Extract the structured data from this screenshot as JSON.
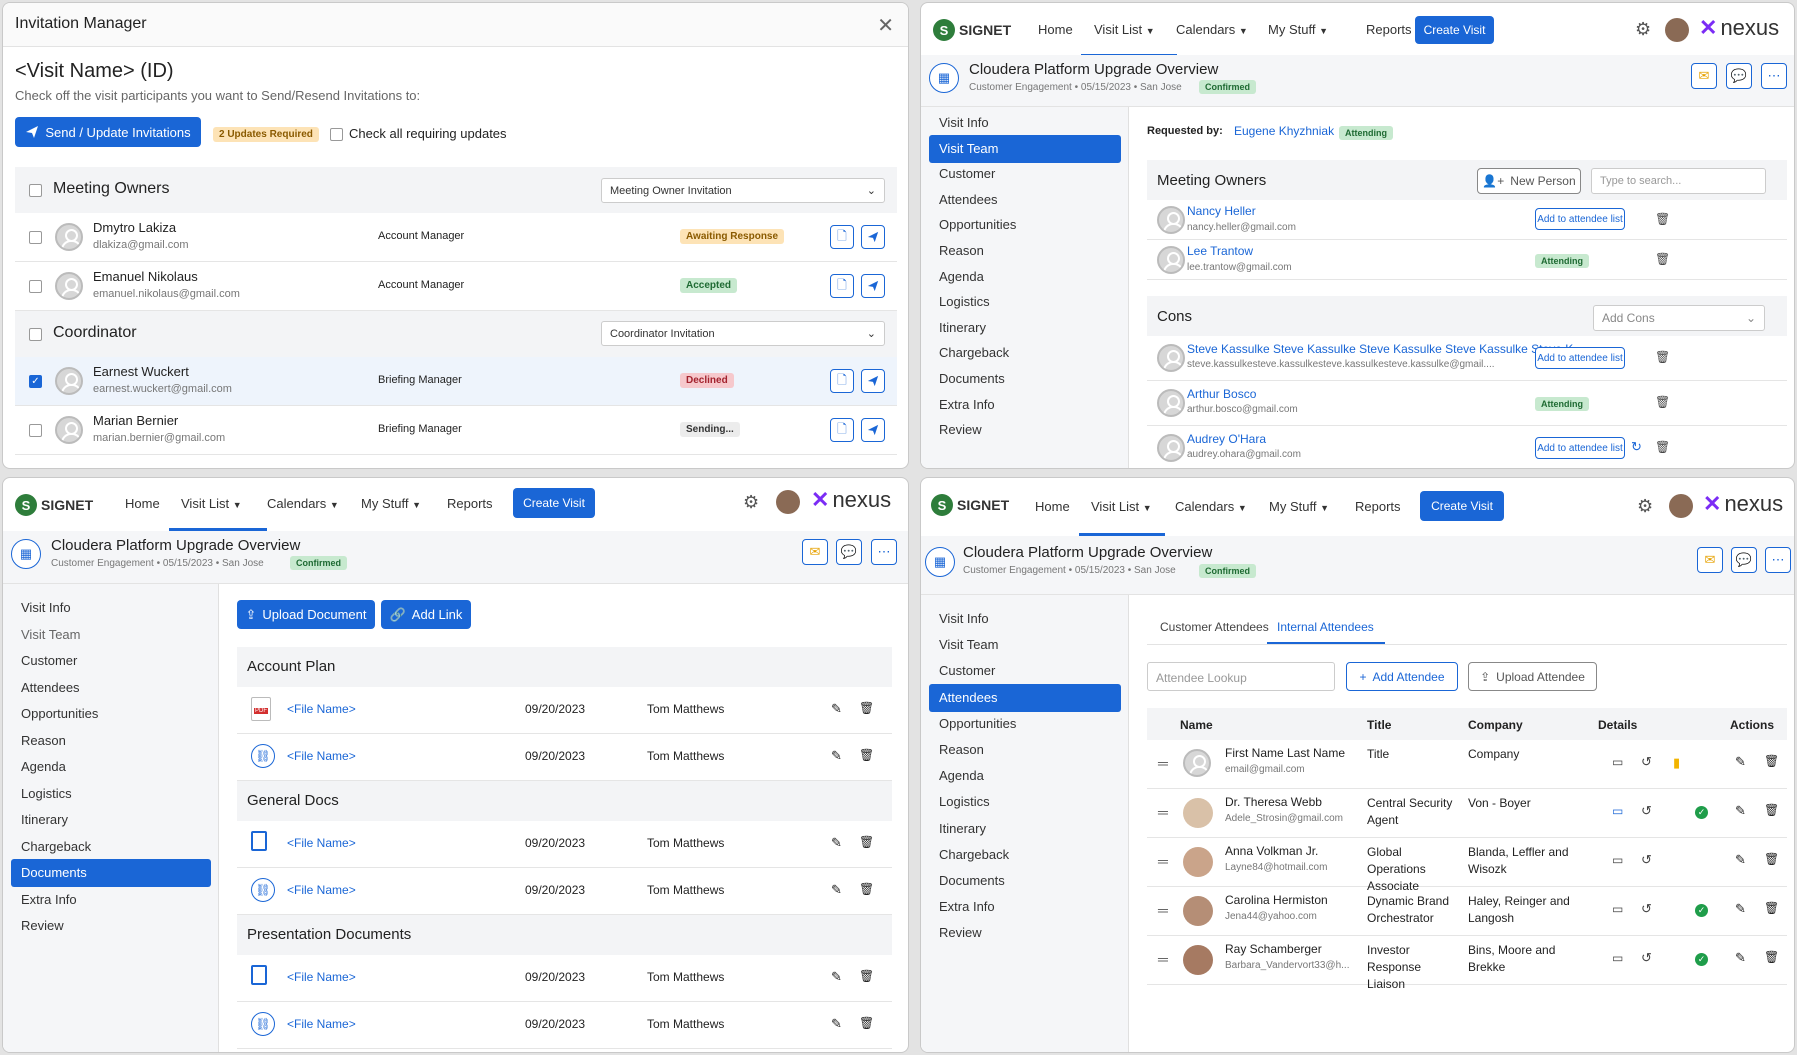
{
  "invitation": {
    "window_title": "Invitation Manager",
    "heading": "<Visit Name> (ID)",
    "instructions": "Check off the visit participants you want to Send/Resend Invitations to:",
    "send_button": "Send / Update Invitations",
    "updates_badge": "2 Updates Required",
    "check_all_label": "Check all requiring updates",
    "groups": [
      {
        "title": "Meeting Owners",
        "select": "Meeting Owner Invitation"
      },
      {
        "title": "Coordinator",
        "select": "Coordinator Invitation"
      }
    ],
    "rows": [
      {
        "name": "Dmytro Lakiza",
        "email": "dlakiza@gmail.com",
        "role": "Account Manager",
        "status": "Awaiting Response"
      },
      {
        "name": "Emanuel Nikolaus",
        "email": "emanuel.nikolaus@gmail.com",
        "role": "Account Manager",
        "status": "Accepted"
      },
      {
        "name": "Earnest Wuckert",
        "email": "earnest.wuckert@gmail.com",
        "role": "Briefing Manager",
        "status": "Declined"
      },
      {
        "name": "Marian Bernier",
        "email": "marian.bernier@gmail.com",
        "role": "Briefing Manager",
        "status": "Sending..."
      }
    ]
  },
  "app": {
    "logo_text": "SIGNET",
    "brand": "nexus",
    "nav": {
      "home": "Home",
      "visit_list": "Visit List",
      "calendars": "Calendars",
      "my_stuff": "My Stuff",
      "reports": "Reports",
      "create_visit": "Create Visit"
    },
    "visit_title": "Cloudera Platform Upgrade Overview",
    "visit_meta": "Customer Engagement • 05/15/2023 • San Jose",
    "visit_status": "Confirmed",
    "sidebar": [
      "Visit Info",
      "Visit Team",
      "Customer",
      "Attendees",
      "Opportunities",
      "Reason",
      "Agenda",
      "Logistics",
      "Itinerary",
      "Chargeback",
      "Documents",
      "Extra Info",
      "Review"
    ]
  },
  "team": {
    "requested_by_label": "Requested by:",
    "requested_by_name": "Eugene Khyzhniak",
    "requested_by_badge": "Attending",
    "owners_title": "Meeting Owners",
    "new_person": "New Person",
    "search_placeholder": "Type to search...",
    "add_to_list": "Add to attendee list",
    "attending": "Attending",
    "owners": [
      {
        "name": "Nancy Heller",
        "email": "nancy.heller@gmail.com"
      },
      {
        "name": "Lee Trantow",
        "email": "lee.trantow@gmail.com"
      }
    ],
    "cons_title": "Cons",
    "add_cons": "Add Cons",
    "cons": [
      {
        "name": "Steve Kassulke Steve Kassulke Steve Kassulke Steve Kassulke Steve K...",
        "email": "steve.kassulkesteve.kassulkesteve.kassulkesteve.kassulke@gmail...."
      },
      {
        "name": "Arthur Bosco",
        "email": "arthur.bosco@gmail.com"
      },
      {
        "name": "Audrey O'Hara",
        "email": "audrey.ohara@gmail.com"
      }
    ]
  },
  "docs": {
    "upload_button": "Upload Document",
    "add_link_button": "Add Link",
    "sections": [
      {
        "title": "Account Plan",
        "files": [
          {
            "name": "<File Name>",
            "date": "09/20/2023",
            "owner": "Tom Matthews"
          },
          {
            "name": "<File Name>",
            "date": "09/20/2023",
            "owner": "Tom Matthews"
          }
        ]
      },
      {
        "title": "General Docs",
        "files": [
          {
            "name": "<File Name>",
            "date": "09/20/2023",
            "owner": "Tom Matthews"
          },
          {
            "name": "<File Name>",
            "date": "09/20/2023",
            "owner": "Tom Matthews"
          }
        ]
      },
      {
        "title": "Presentation Documents",
        "files": [
          {
            "name": "<File Name>",
            "date": "09/20/2023",
            "owner": "Tom Matthews"
          },
          {
            "name": "<File Name>",
            "date": "09/20/2023",
            "owner": "Tom Matthews"
          }
        ]
      }
    ]
  },
  "attendees": {
    "tab_customer": "Customer Attendees",
    "tab_internal": "Internal Attendees",
    "lookup_placeholder": "Attendee Lookup",
    "add_attendee": "Add Attendee",
    "upload_attendee": "Upload Attendee",
    "columns": {
      "name": "Name",
      "title": "Title",
      "company": "Company",
      "details": "Details",
      "actions": "Actions"
    },
    "rows": [
      {
        "name": "First Name Last Name",
        "email": "email@gmail.com",
        "title": "Title",
        "company": "Company"
      },
      {
        "name": "Dr. Theresa Webb",
        "email": "Adele_Strosin@gmail.com",
        "title": "Central Security Agent",
        "company": "Von - Boyer"
      },
      {
        "name": "Anna Volkman Jr.",
        "email": "Layne84@hotmail.com",
        "title": "Global Operations Associate",
        "company": "Blanda, Leffler and Wisozk"
      },
      {
        "name": "Carolina Hermiston",
        "email": "Jena44@yahoo.com",
        "title": "Dynamic Brand Orchestrator",
        "company": "Haley, Reinger and Langosh"
      },
      {
        "name": "Ray Schamberger",
        "email": "Barbara_Vandervort33@h...",
        "title": "Investor Response Liaison",
        "company": "Bins, Moore and Brekke"
      }
    ]
  },
  "colors": {
    "accent": "#1a66d6",
    "brand_purple": "#7b2cf5"
  }
}
